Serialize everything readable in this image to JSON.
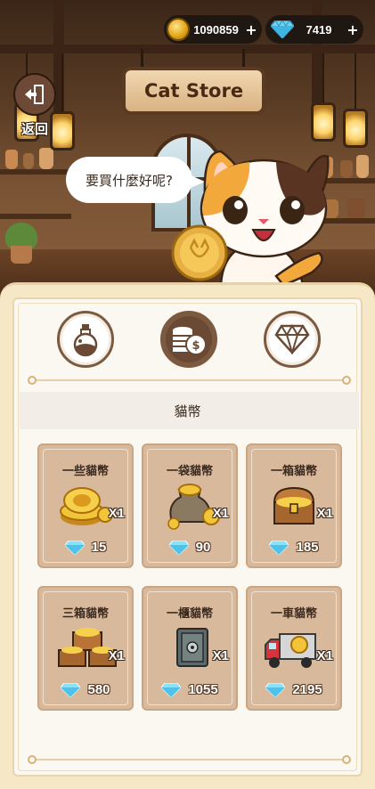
{
  "header": {
    "coins": {
      "value": "1090859",
      "plus": "+"
    },
    "gems": {
      "value": "7419",
      "plus": "+"
    }
  },
  "back_button": {
    "label": "返回"
  },
  "sign": {
    "text": "Cat Store"
  },
  "speech_bubble": {
    "text": "要買什麼好呢?"
  },
  "tabs": [
    {
      "name": "potion-tab",
      "icon": "potion-icon",
      "active": false
    },
    {
      "name": "coins-tab",
      "icon": "coin-stack-icon",
      "active": true
    },
    {
      "name": "gems-tab",
      "icon": "diamond-icon",
      "active": false
    }
  ],
  "section": {
    "title": "貓幣"
  },
  "items": [
    {
      "title": "一些貓幣",
      "qty": "X1",
      "price": "15",
      "icon": "gold-coins-icon"
    },
    {
      "title": "一袋貓幣",
      "qty": "X1",
      "price": "90",
      "icon": "coin-bag-icon"
    },
    {
      "title": "一箱貓幣",
      "qty": "X1",
      "price": "185",
      "icon": "treasure-chest-icon"
    },
    {
      "title": "三箱貓幣",
      "qty": "X1",
      "price": "580",
      "icon": "three-chests-icon"
    },
    {
      "title": "一櫃貓幣",
      "qty": "X1",
      "price": "1055",
      "icon": "safe-icon"
    },
    {
      "title": "一車貓幣",
      "qty": "X1",
      "price": "2195",
      "icon": "coin-truck-icon"
    }
  ],
  "colors": {
    "panel_bg": "#f6e8c6",
    "card_bg": "#d9b99b",
    "tab_active": "#7c5a40",
    "pill_bg": "#1f1712",
    "gem": "#6fd4f2"
  }
}
